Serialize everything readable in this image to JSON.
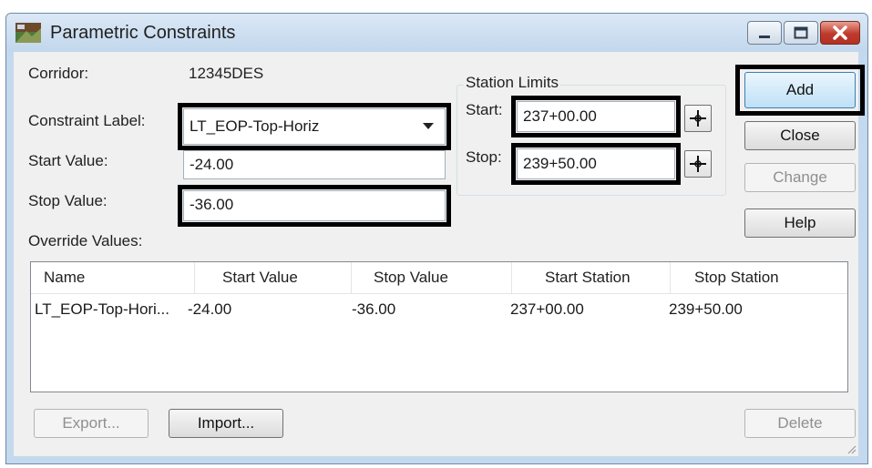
{
  "window": {
    "title": "Parametric Constraints"
  },
  "form": {
    "corridor_label": "Corridor:",
    "corridor_value": "12345DES",
    "constraint_label_label": "Constraint Label:",
    "constraint_label_value": "LT_EOP-Top-Horiz",
    "start_value_label": "Start Value:",
    "start_value": "-24.00",
    "stop_value_label": "Stop Value:",
    "stop_value": "-36.00",
    "override_label": "Override Values:"
  },
  "station_limits": {
    "title": "Station Limits",
    "start_label": "Start:",
    "start_value": "237+00.00",
    "stop_label": "Stop:",
    "stop_value": "239+50.00"
  },
  "buttons": {
    "add": "Add",
    "close": "Close",
    "change": "Change",
    "help": "Help",
    "export": "Export...",
    "import": "Import...",
    "delete": "Delete"
  },
  "table": {
    "columns": [
      "Name",
      "Start Value",
      "Stop Value",
      "Start Station",
      "Stop Station"
    ],
    "rows": [
      [
        "LT_EOP-Top-Hori...",
        "-24.00",
        "-36.00",
        "237+00.00",
        "239+50.00"
      ]
    ]
  }
}
